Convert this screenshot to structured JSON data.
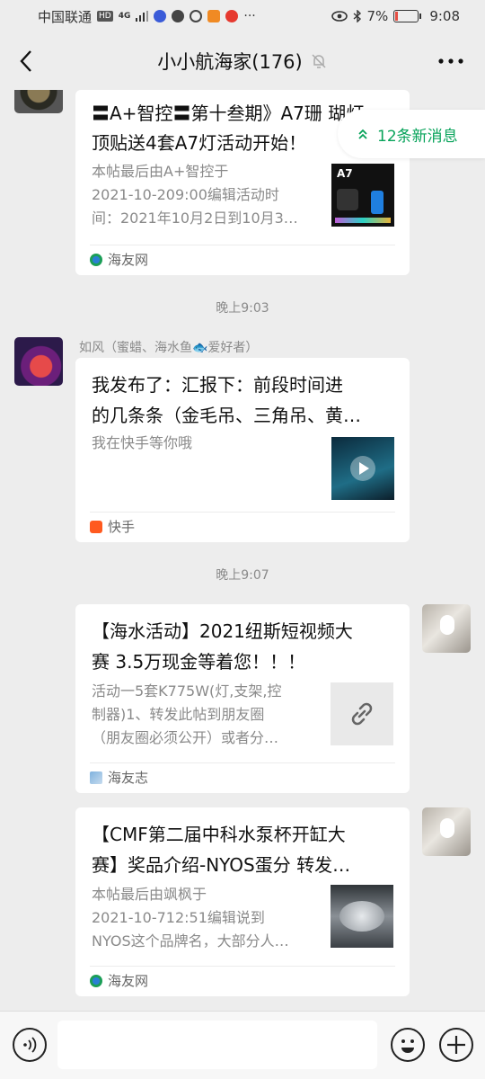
{
  "status_bar": {
    "carrier": "中国联通",
    "hd": "HD",
    "net": "4G",
    "battery": "7%",
    "time": "9:08"
  },
  "header": {
    "title": "小小航海家(176)"
  },
  "new_messages": "12条新消息",
  "messages": [
    {
      "title_line1": "〓A+智控〓第十叁期》A7珊 瑚灯",
      "title_line2": "顶贴送4套A7灯活动开始！",
      "desc_line1": "本帖最后由A+智控于",
      "desc_line2": "2021-10-209:00编辑活动时",
      "desc_line3": "间：2021年10月2日到10月3…",
      "thumb_label": "A7",
      "source": "海友网"
    },
    {
      "timestamp": "晚上9:03",
      "sender": "如风（蜜蜡、海水鱼🐟爱好者）",
      "title_line1": "我发布了：汇报下：前段时间进",
      "title_line2": "的几条条（金毛吊、三角吊、黄…",
      "desc_line1": "我在快手等你哦",
      "source": "快手"
    },
    {
      "timestamp": "晚上9:07",
      "title_line1": "【海水活动】2021纽斯短视频大",
      "title_line2": "赛 3.5万现金等着您！！！",
      "desc_line1": "活动一5套K775W(灯,支架,控",
      "desc_line2": "制器)1、转发此帖到朋友圈",
      "desc_line3": "（朋友圈必须公开）或者分…",
      "source": "海友志"
    },
    {
      "title_line1": "【CMF第二届中科水泵杯开缸大",
      "title_line2": "赛】奖品介绍-NYOS蛋分 转发…",
      "desc_line1": "本帖最后由飒枫于",
      "desc_line2": "2021-10-712:51编辑说到",
      "desc_line3": "NYOS这个品牌名，大部分人…",
      "source": "海友网"
    }
  ],
  "colors": {
    "background": "#ededed",
    "accent_green": "#07a35a",
    "card": "#ffffff"
  }
}
